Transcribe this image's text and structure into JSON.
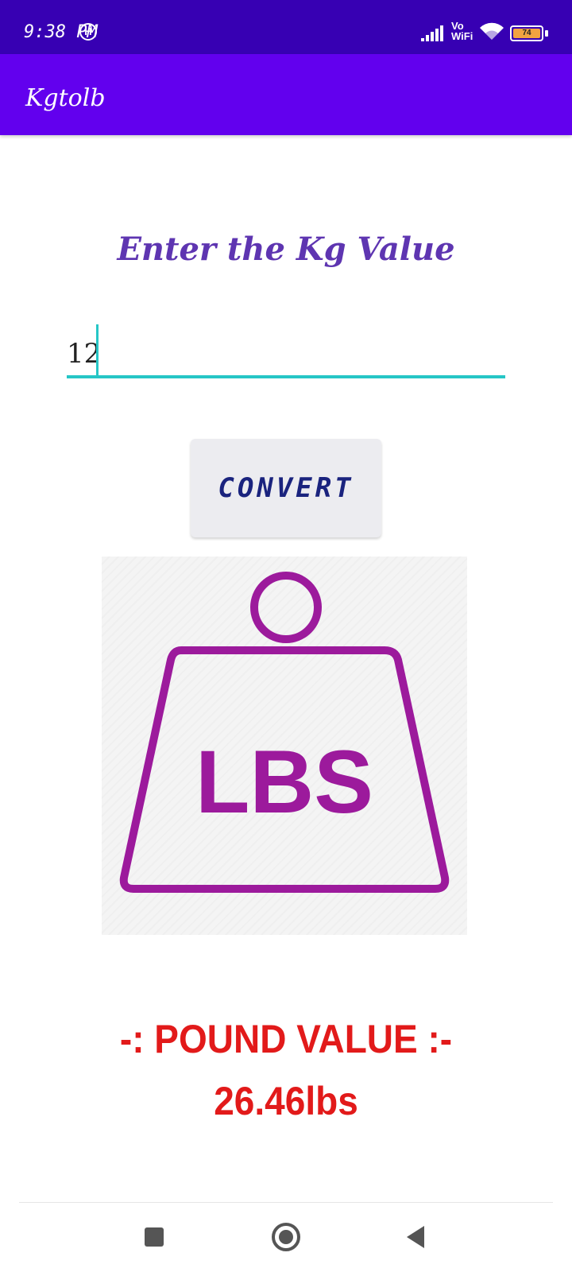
{
  "status_bar": {
    "time": "9:38 PM",
    "carrier_icon": "H",
    "vo_label": "Vo",
    "wifi_label": "WiFi",
    "battery_level": "74"
  },
  "app_bar": {
    "title": "Kgtolb"
  },
  "main": {
    "prompt": "Enter the Kg Value",
    "kg_input_value": "12",
    "convert_label": "CONVERT",
    "image_text": "LBS",
    "result_label": "-: POUND VALUE :-",
    "result_value": "26.46lbs"
  },
  "colors": {
    "status_bar": "#3700b3",
    "app_bar": "#6200ee",
    "prompt": "#5e35b1",
    "input_underline": "#26c6c6",
    "weight_icon": "#9c1a9c",
    "result": "#e21a1a"
  }
}
